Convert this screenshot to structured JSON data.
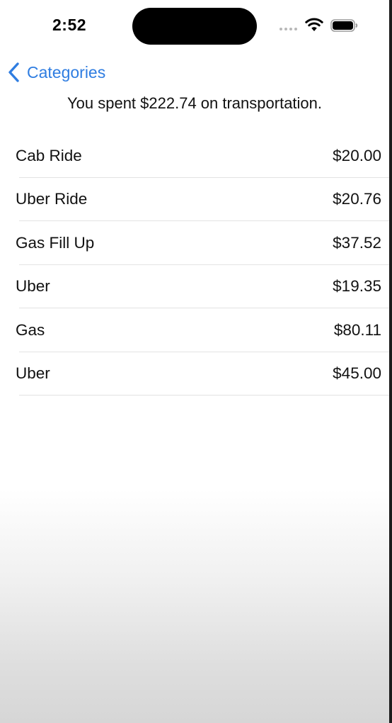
{
  "status_bar": {
    "time": "2:52"
  },
  "nav": {
    "back_label": "Categories"
  },
  "summary": "You spent $222.74 on transportation.",
  "transactions": [
    {
      "name": "Cab Ride",
      "amount": "$20.00"
    },
    {
      "name": "Uber Ride",
      "amount": "$20.76"
    },
    {
      "name": "Gas Fill Up",
      "amount": "$37.52"
    },
    {
      "name": "Uber",
      "amount": "$19.35"
    },
    {
      "name": "Gas",
      "amount": "$80.11"
    },
    {
      "name": "Uber",
      "amount": "$45.00"
    }
  ],
  "colors": {
    "accent": "#2f7de1"
  },
  "icons": {
    "back": "chevron-left-icon",
    "wifi": "wifi-icon",
    "battery": "battery-icon"
  }
}
